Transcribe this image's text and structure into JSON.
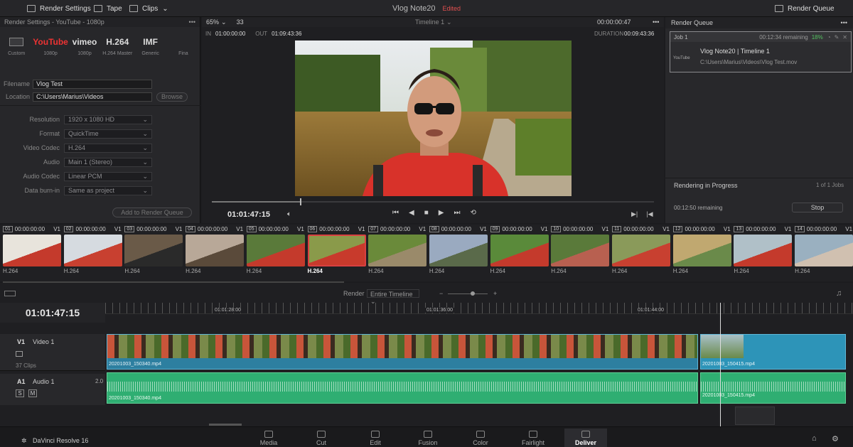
{
  "topbar": {
    "render_settings": "Render Settings",
    "tape": "Tape",
    "clips": "Clips",
    "project": "Vlog Note20",
    "edited": "Edited",
    "render_queue": "Render Queue"
  },
  "render_settings": {
    "panel_title": "Render Settings - YouTube - 1080p",
    "presets": [
      {
        "logo": "",
        "label": "Custom"
      },
      {
        "logo": "YouTube",
        "label": "1080p"
      },
      {
        "logo": "vimeo",
        "label": "1080p"
      },
      {
        "logo": "H.264",
        "label": "H.264 Master"
      },
      {
        "logo": "IMF",
        "label": "Generic"
      },
      {
        "logo": "",
        "label": "Fina"
      }
    ],
    "filename_label": "Filename",
    "filename": "Vlog Test",
    "location_label": "Location",
    "location": "C:\\Users\\Marius\\Videos",
    "browse": "Browse",
    "fields": [
      {
        "label": "Resolution",
        "value": "1920 x 1080 HD"
      },
      {
        "label": "Format",
        "value": "QuickTime"
      },
      {
        "label": "Video Codec",
        "value": "H.264"
      },
      {
        "label": "Audio",
        "value": "Main 1 (Stereo)"
      },
      {
        "label": "Audio Codec",
        "value": "Linear PCM"
      },
      {
        "label": "Data burn-in",
        "value": "Same as project"
      }
    ],
    "add_to_queue": "Add to Render Queue"
  },
  "viewer": {
    "zoom": "65%",
    "zoom_value": "33",
    "timeline": "Timeline 1",
    "timecode_top": "00:00:00:47",
    "in_label": "IN",
    "in": "01:00:00:00",
    "out_label": "OUT",
    "out": "01:09:43:36",
    "duration_label": "DURATION",
    "duration": "00:09:43:36",
    "timecode": "01:01:47:15",
    "scrub_progress": 0.2
  },
  "render_queue": {
    "title": "Render Queue",
    "job": "Job 1",
    "remaining": "00:12:34 remaining",
    "percent": "18%",
    "job_title": "Vlog Note20 | Timeline 1",
    "job_path": "C:\\Users\\Marius\\Videos\\Vlog Test.mov",
    "logo": "YouTube",
    "progress_title": "Rendering in Progress",
    "jobs_count": "1 of 1 Jobs",
    "progress_remaining": "00:12:50 remaining",
    "stop": "Stop"
  },
  "clips": [
    {
      "num": "01",
      "tc": "00:00:00:00",
      "track": "V1",
      "codec": "H.264",
      "colors": [
        "#e8e4dc",
        "#c43a2c"
      ]
    },
    {
      "num": "02",
      "tc": "00:00:00:00",
      "track": "V1",
      "codec": "H.264",
      "colors": [
        "#d6dbe0",
        "#c84030"
      ]
    },
    {
      "num": "03",
      "tc": "00:00:00:00",
      "track": "V1",
      "codec": "H.264",
      "colors": [
        "#6a5a48",
        "#2a2a2a"
      ]
    },
    {
      "num": "04",
      "tc": "00:00:00:00",
      "track": "V1",
      "codec": "H.264",
      "colors": [
        "#b8a898",
        "#5a4a3a"
      ]
    },
    {
      "num": "05",
      "tc": "00:00:00:00",
      "track": "V1",
      "codec": "H.264",
      "colors": [
        "#5a7a3a",
        "#c43a2c"
      ]
    },
    {
      "num": "06",
      "tc": "00:00:00:00",
      "track": "V1",
      "codec": "H.264",
      "colors": [
        "#8a9a4a",
        "#c83a2c"
      ]
    },
    {
      "num": "07",
      "tc": "00:00:00:00",
      "track": "V1",
      "codec": "H.264",
      "colors": [
        "#6a8a3a",
        "#9a8a6a"
      ]
    },
    {
      "num": "08",
      "tc": "00:00:00:00",
      "track": "V1",
      "codec": "H.264",
      "colors": [
        "#9aaac0",
        "#5a6a4a"
      ]
    },
    {
      "num": "09",
      "tc": "00:00:00:00",
      "track": "V1",
      "codec": "H.264",
      "colors": [
        "#5a8a3a",
        "#c43a2c"
      ]
    },
    {
      "num": "10",
      "tc": "00:00:00:00",
      "track": "V1",
      "codec": "H.264",
      "colors": [
        "#5a7a3a",
        "#b86050"
      ]
    },
    {
      "num": "11",
      "tc": "00:00:00:00",
      "track": "V1",
      "codec": "H.264",
      "colors": [
        "#8a9a5a",
        "#c84030"
      ]
    },
    {
      "num": "12",
      "tc": "00:00:00:00",
      "track": "V1",
      "codec": "H.264",
      "colors": [
        "#c0a870",
        "#6a8a4a"
      ]
    },
    {
      "num": "13",
      "tc": "00:00:00:00",
      "track": "V1",
      "codec": "H.264",
      "colors": [
        "#b0c0c8",
        "#c43a2c"
      ]
    },
    {
      "num": "14",
      "tc": "00:00:00:00",
      "track": "V1",
      "codec": "H.264",
      "colors": [
        "#9ab0c0",
        "#d0c0b0"
      ]
    }
  ],
  "timeline": {
    "render_label": "Render",
    "render_mode": "Entire Timeline",
    "timecode": "01:01:47:15",
    "ruler": [
      "01:01:28:00",
      "01:01:36:00",
      "01:01:44:00"
    ],
    "v1_label": "V1",
    "v1_name": "Video 1",
    "v1_count": "37 Clips",
    "a1_label": "A1",
    "a1_name": "Audio 1",
    "a1_level": "2.0",
    "solo": "S",
    "mute": "M",
    "clip1": "20201003_150340.mp4",
    "clip2": "20201003_150415.mp4"
  },
  "pages": [
    "Media",
    "Cut",
    "Edit",
    "Fusion",
    "Color",
    "Fairlight",
    "Deliver"
  ],
  "active_page": "Deliver",
  "app_name": "DaVinci Resolve 16"
}
